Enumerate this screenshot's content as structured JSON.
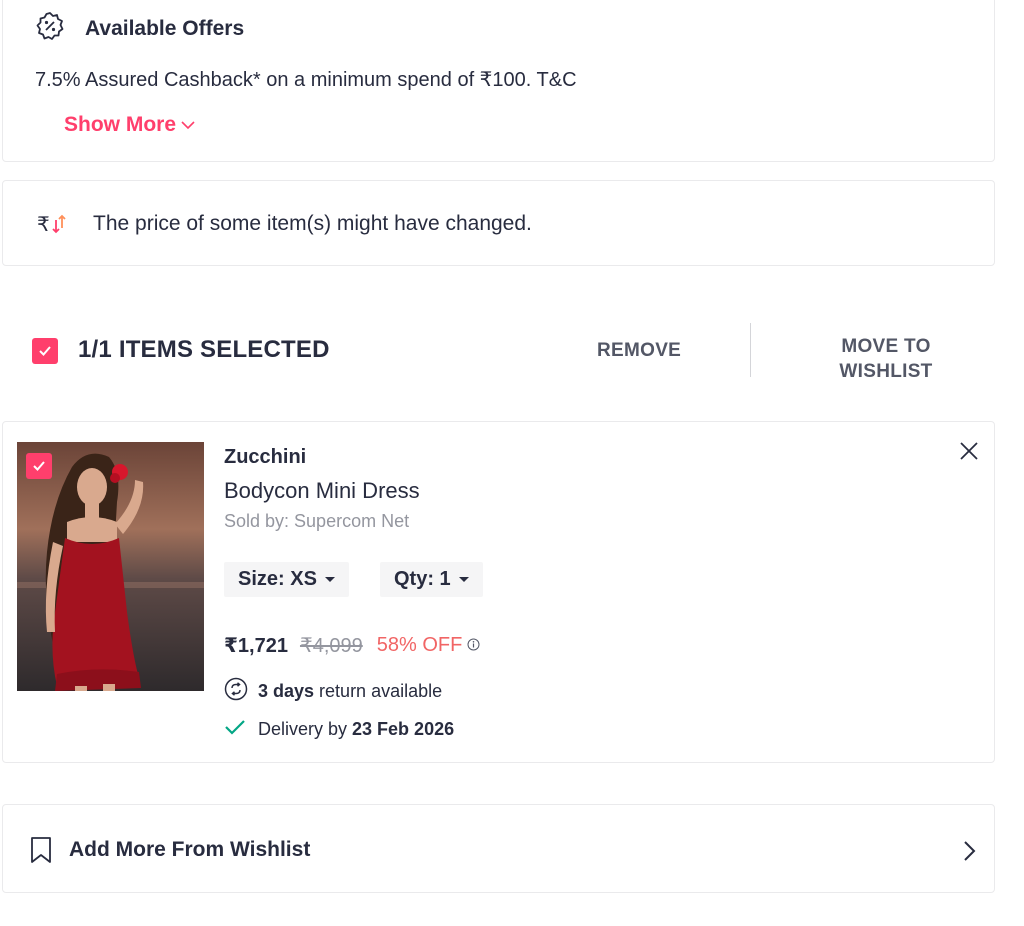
{
  "offers": {
    "title": "Available Offers",
    "icon": "discount-badge-icon",
    "text": "7.5% Assured Cashback* on a minimum spend of ₹100. T&C",
    "show_more_label": "Show More"
  },
  "price_change": {
    "icon": "rupee-price-change-icon",
    "text": "The price of some item(s) might have changed."
  },
  "selection": {
    "count_label": "1/1 ITEMS SELECTED",
    "remove_label": "REMOVE",
    "move_label_line1": "MOVE TO",
    "move_label_line2": "WISHLIST"
  },
  "item": {
    "brand": "Zucchini",
    "name": "Bodycon Mini Dress",
    "seller": "Sold by: Supercom Net",
    "size_label": "Size: XS",
    "qty_label": "Qty: 1",
    "price": "₹1,721",
    "mrp": "₹4,099",
    "discount": "58% OFF",
    "return_days": "3 days",
    "return_text": " return available",
    "delivery_prefix": "Delivery by ",
    "delivery_date": "23 Feb 2026"
  },
  "wishlist": {
    "label": "Add More From Wishlist"
  },
  "colors": {
    "accent": "#ff3f6c",
    "text_primary": "#282c3f",
    "text_muted": "#94969f",
    "discount": "#f16565",
    "success": "#03a685"
  }
}
